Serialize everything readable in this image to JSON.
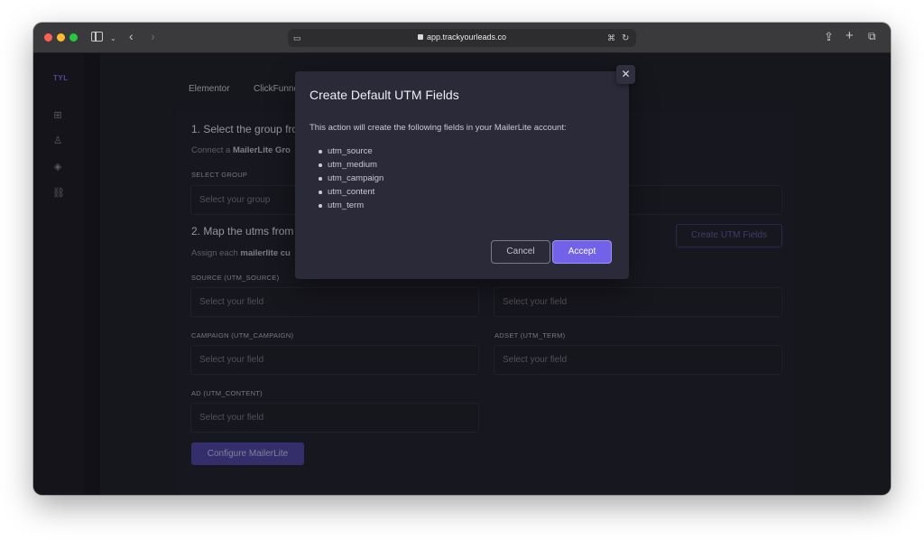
{
  "browser": {
    "url": "app.trackyourleads.co",
    "icons": [
      "sidebar-toggle-icon",
      "chevron-down-icon",
      "back-icon",
      "forward-icon",
      "reader-icon",
      "lock-icon",
      "translate-icon",
      "reload-icon",
      "share-icon",
      "new-tab-icon",
      "tab-overview-icon"
    ]
  },
  "app": {
    "logo": "TYL",
    "nav_icons": [
      "dashboard-icon",
      "user-icon",
      "target-icon",
      "link-icon"
    ]
  },
  "tabs": [
    "Elementor",
    "ClickFunne"
  ],
  "section1": {
    "title": "1. Select the group fro",
    "desc_prefix": "Connect a ",
    "desc_bold": "MailerLite Gro",
    "select_label": "SELECT GROUP",
    "select_placeholder": "Select your group"
  },
  "section2": {
    "title": "2. Map the utms from",
    "desc_prefix": "Assign each ",
    "desc_bold": "mailerlite cu",
    "create_button": "Create UTM Fields",
    "fields": [
      {
        "label": "SOURCE (UTM_SOURCE)",
        "placeholder": "Select your field"
      },
      {
        "label": "",
        "placeholder": "Select your field"
      },
      {
        "label": "CAMPAIGN (UTM_CAMPAIGN)",
        "placeholder": "Select your field"
      },
      {
        "label": "ADSET (UTM_TERM)",
        "placeholder": "Select your field"
      },
      {
        "label": "AD (UTM_CONTENT)",
        "placeholder": "Select your field"
      }
    ],
    "configure_button": "Configure MailerLite"
  },
  "modal": {
    "title": "Create Default UTM Fields",
    "body": "This action will create the following fields in your MailerLite account:",
    "items": [
      "utm_source",
      "utm_medium",
      "utm_campaign",
      "utm_content",
      "utm_term"
    ],
    "cancel_label": "Cancel",
    "accept_label": "Accept",
    "close_glyph": "✕"
  },
  "colors": {
    "accent": "#7262e8",
    "background": "#1d1d27",
    "modal": "#2a2a39"
  }
}
